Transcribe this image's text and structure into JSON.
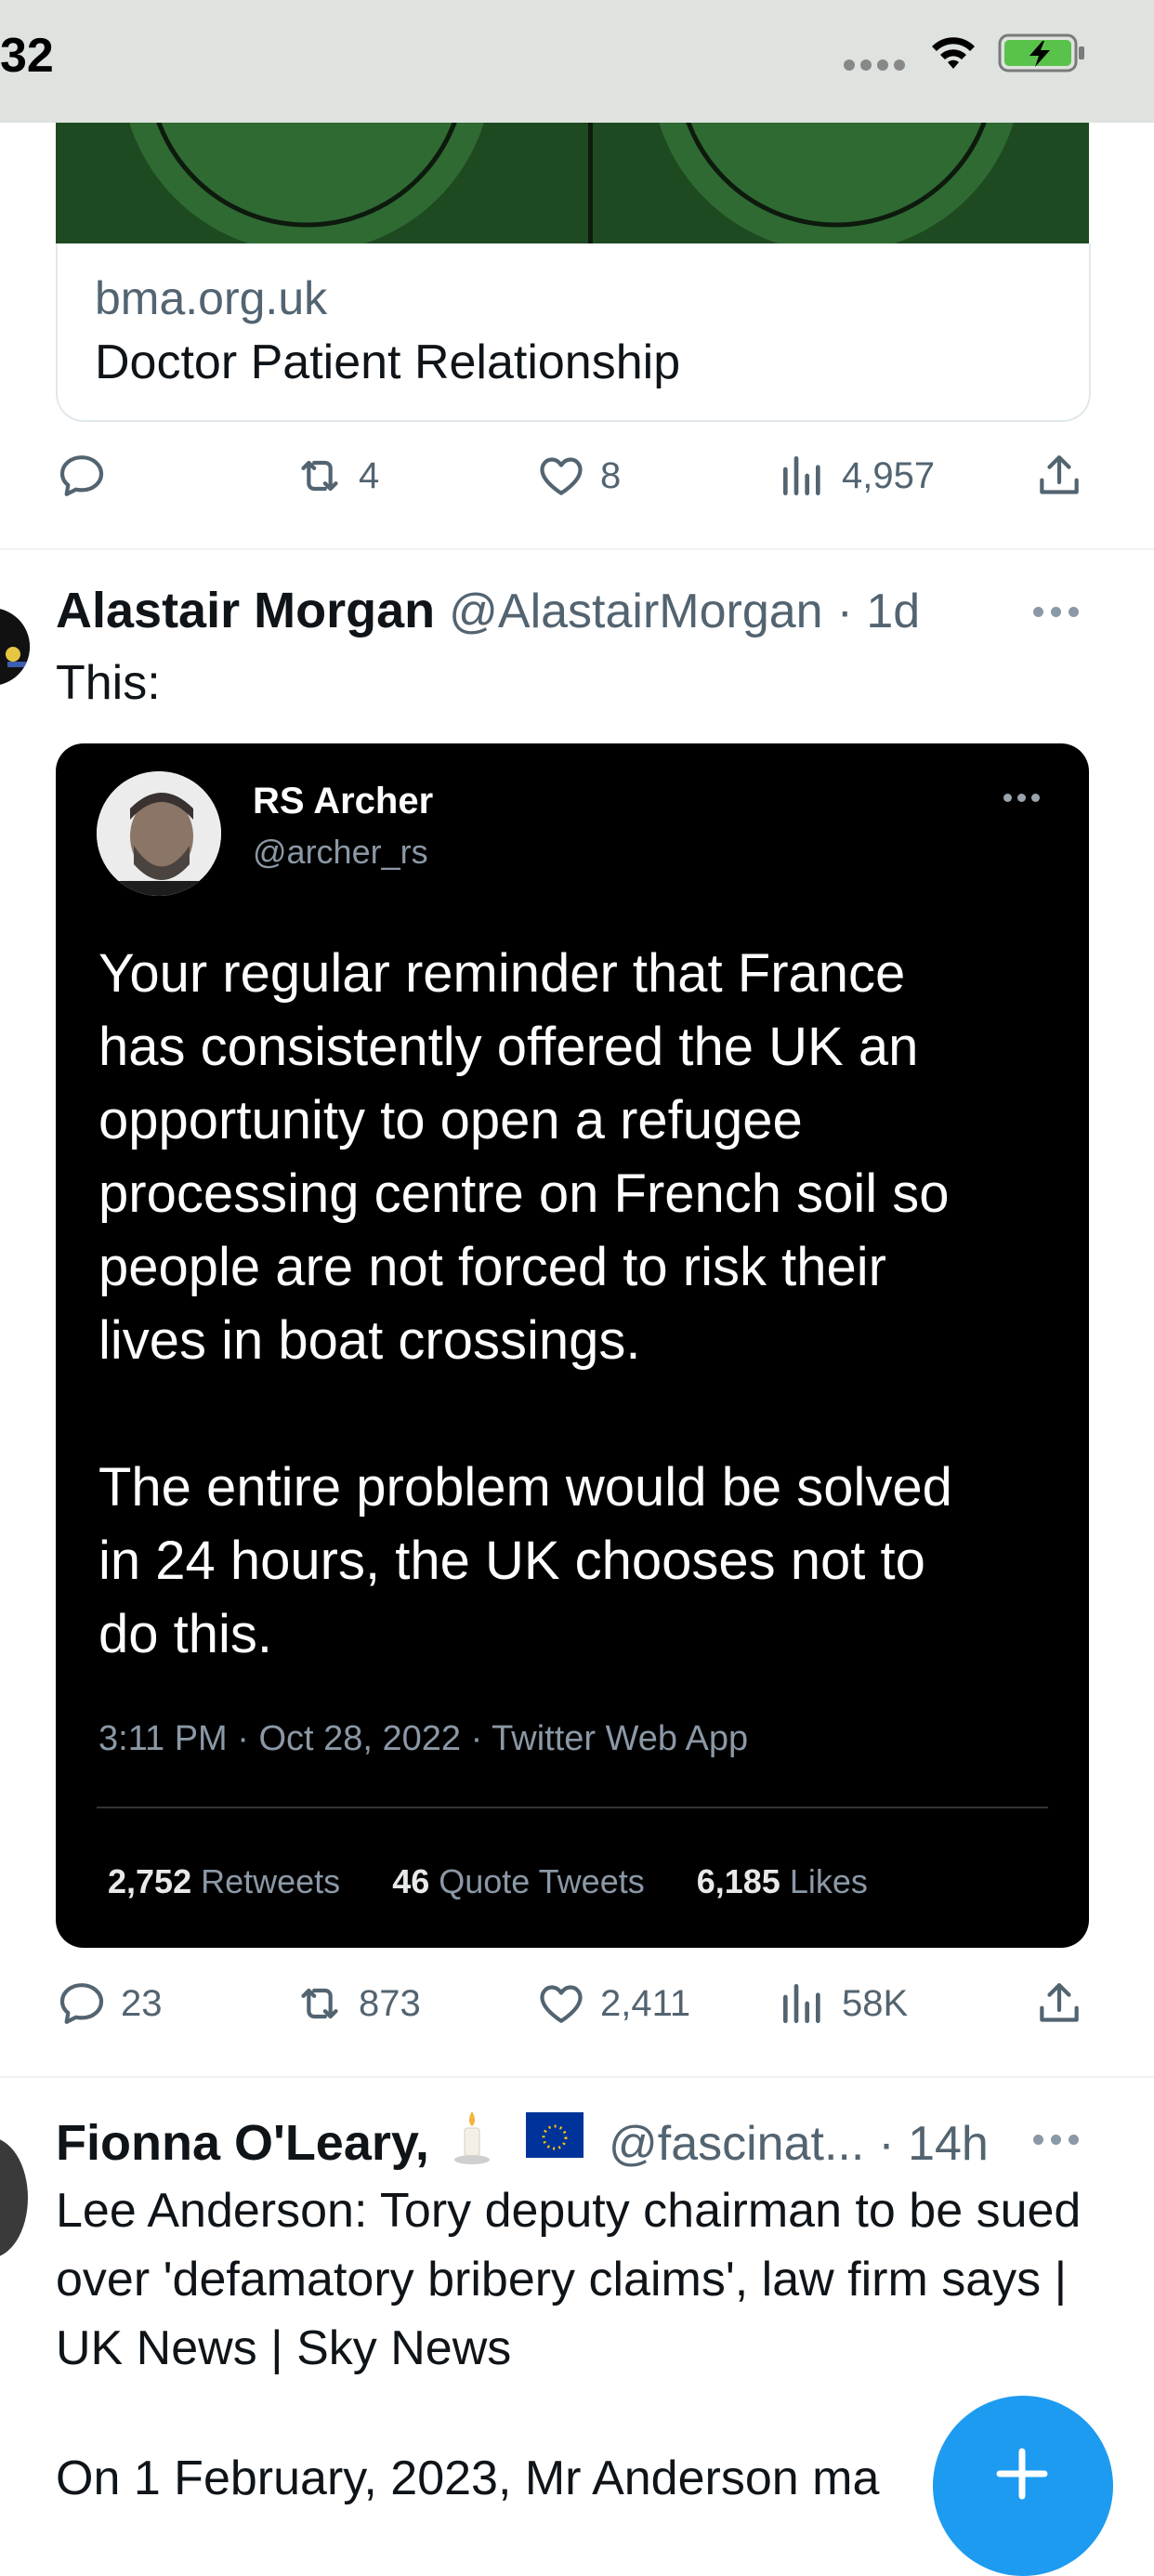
{
  "status_bar": {
    "time": "32"
  },
  "link_card": {
    "domain": "bma.org.uk",
    "title": "Doctor Patient Relationship"
  },
  "tweet1_actions": {
    "reply": "",
    "retweets": "4",
    "likes": "8",
    "views": "4,957"
  },
  "tweet2": {
    "author": "Alastair Morgan",
    "handle": "@AlastairMorgan",
    "time": "· 1d",
    "text": "This:",
    "embedded": {
      "name": "RS Archer",
      "handle": "@archer_rs",
      "body": "Your regular reminder that France\nhas consistently offered the UK an\nopportunity to open a refugee\nprocessing centre on French soil so\npeople are not forced to risk their\nlives in boat crossings.\n\nThe entire problem would be solved\nin 24 hours, the UK chooses not to\ndo this.",
      "meta": "3:11 PM · Oct 28, 2022 · Twitter Web App",
      "retweets_count": "2,752",
      "retweets_label": "Retweets",
      "quotes_count": "46",
      "quotes_label": "Quote Tweets",
      "likes_count": "6,185",
      "likes_label": "Likes"
    },
    "actions": {
      "replies": "23",
      "retweets": "873",
      "likes": "2,411",
      "views": "58K"
    }
  },
  "tweet3": {
    "author": "Fionna O'Leary,",
    "handle": "@fascinat...",
    "time": "· 14h",
    "text": "Lee Anderson: Tory deputy chairman to be sued over 'defamatory bribery claims', law firm says | UK News | Sky News",
    "text2": "On 1 February, 2023, Mr Anderson ma"
  },
  "fab": {
    "icon": "plus-icon"
  },
  "colors": {
    "accent": "#1d9bf0",
    "muted": "#536471",
    "text": "#0f1419"
  }
}
